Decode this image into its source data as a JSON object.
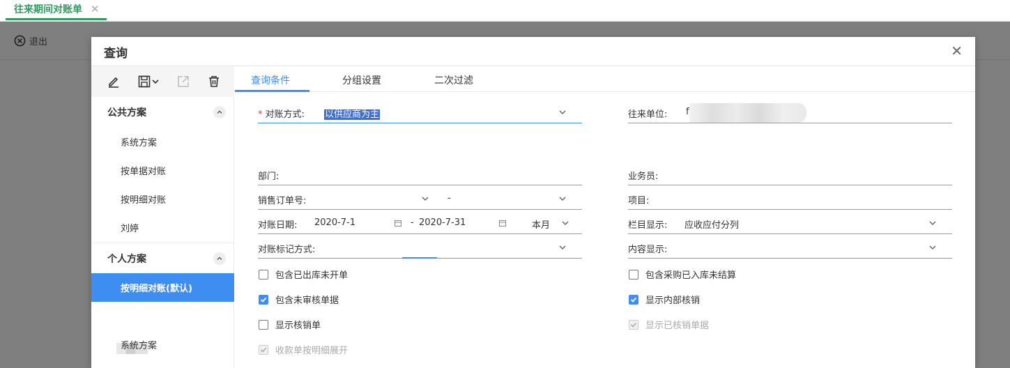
{
  "page_tab": {
    "title": "往来期间对账单",
    "close": "✕"
  },
  "bg_toolbar": {
    "exit_label": "退出"
  },
  "modal": {
    "title": "查询",
    "close": "✕",
    "left": {
      "public_section": "公共方案",
      "public_items": [
        "系统方案",
        "按单据对账",
        "按明细对账",
        "刘婷"
      ],
      "personal_section": "个人方案",
      "personal_items": [
        "按明细对账(默认)",
        "系统方案"
      ]
    },
    "tabs": [
      "查询条件",
      "分组设置",
      "二次过滤"
    ],
    "form": {
      "recon_mode_label": "对账方式:",
      "recon_mode_value": "以供应商为主",
      "partner_label": "往来单位:",
      "partner_value": "f",
      "dept_label": "部门:",
      "salesman_label": "业务员:",
      "so_label": "销售订单号:",
      "so_sep": "-",
      "project_label": "项目:",
      "date_label": "对账日期:",
      "date_from": "2020-7-1",
      "date_sep": "-",
      "date_to": "2020-7-31",
      "date_period": "本月",
      "column_label": "栏目显示:",
      "column_value": "应收应付分列",
      "mark_label": "对账标记方式:",
      "content_label": "内容显示:"
    },
    "checks": {
      "c1": "包含已出库未开单",
      "c2": "包含未审核单据",
      "c3": "显示核销单",
      "c4": "收款单按明细展开",
      "c5": "包含采购已入库未结算",
      "c6": "显示内部核销",
      "c7": "显示已核销单据"
    },
    "required_mark": "*"
  },
  "colors": {
    "accent": "#3d8ef0",
    "brand_green": "#2e9c5f"
  }
}
